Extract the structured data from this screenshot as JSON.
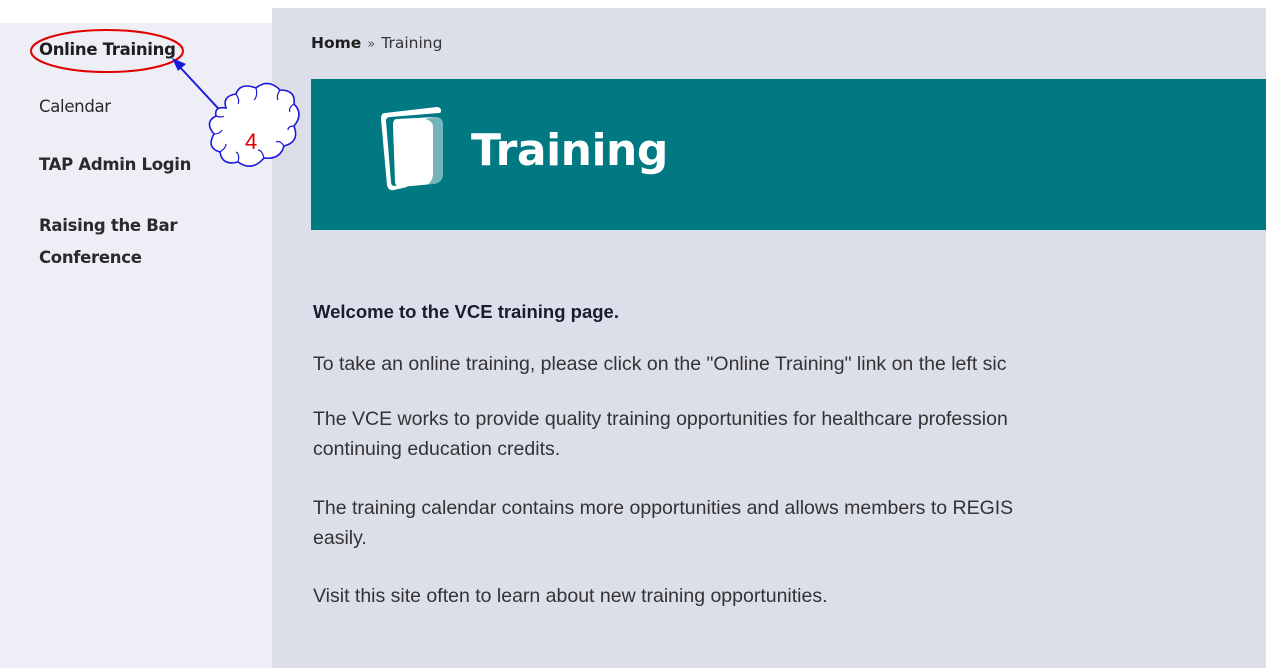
{
  "sidebar": {
    "items": [
      {
        "label": "Online Training"
      },
      {
        "label": "Calendar"
      },
      {
        "label": "TAP Admin Login"
      },
      {
        "label": "Raising the Bar Conference"
      }
    ]
  },
  "breadcrumb": {
    "home": "Home",
    "separator": "»",
    "current": "Training"
  },
  "banner": {
    "title": "Training",
    "color": "#007983",
    "icon": "training-logo-icon"
  },
  "main": {
    "welcome": "Welcome to the VCE training page.",
    "paragraphs": [
      "To take an online training, please click on the \"Online Training\" link on the left sic",
      "The VCE works to provide quality training opportunities for healthcare profession",
      "continuing education credits.",
      "The training calendar contains more opportunities and allows members to REGIS",
      "easily.",
      "Visit this site often to learn about new training opportunities."
    ]
  },
  "annotation": {
    "step_number": "4",
    "color": "#e00000",
    "arrow_color": "#1a1ad8"
  }
}
